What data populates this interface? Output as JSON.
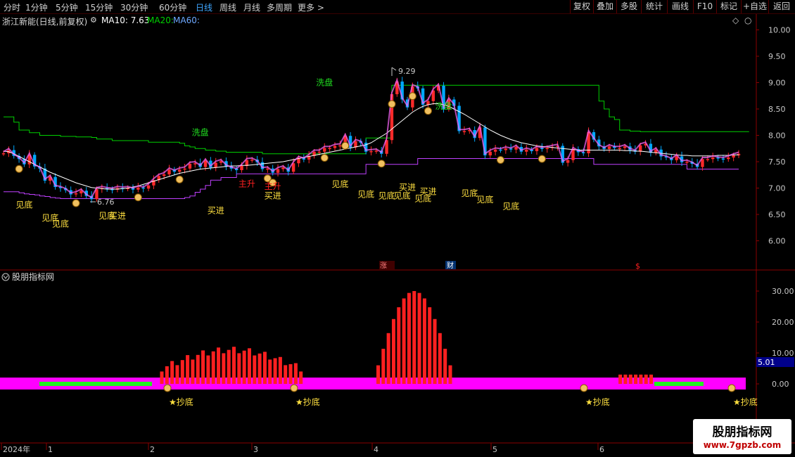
{
  "toolbar": {
    "timeframes": [
      "分时",
      "1分钟",
      "5分钟",
      "15分钟",
      "30分钟",
      "60分钟",
      "日线",
      "周线",
      "月线",
      "多周期",
      "更多 >"
    ],
    "active_timeframe": "日线",
    "right_buttons": [
      "复权",
      "叠加",
      "多股",
      "统计",
      "画线",
      "F10",
      "标记",
      "+自选",
      "返回"
    ]
  },
  "main_panel": {
    "stock_title": "浙江新能(日线,前复权)",
    "ma10_label": "MA10: 7.63",
    "ma20_label": "MA20:",
    "ma60_label": "MA60:",
    "colors": {
      "ma10": "#ffffff",
      "ma20": "#00d000",
      "ma60": "#6ea8ff",
      "up": "#ff2a2a",
      "down": "#00a8ff",
      "pink": "#ff66ff"
    },
    "high_marker": "9.29",
    "low_marker": "6.76",
    "event_labels": [
      "涨",
      "财",
      "$"
    ]
  },
  "indicator_panel": {
    "title": "股朋指标网",
    "current_value": "5.01",
    "signal_label": "★抄底"
  },
  "time_axis": [
    "2024年",
    "1",
    "2",
    "3",
    "4",
    "5",
    "6"
  ],
  "watermark": {
    "line1": "股朋指标网",
    "line2": "www.7gpzb.com"
  },
  "chart_data": [
    {
      "type": "candlestick",
      "title": "浙江新能(日线,前复权)",
      "y_ticks": [
        "10.00",
        "9.50",
        "9.00",
        "8.50",
        "8.00",
        "7.50",
        "7.00",
        "6.50",
        "6.00"
      ],
      "ylim": [
        5.6,
        10.1
      ],
      "close": [
        7.66,
        7.72,
        7.61,
        7.55,
        7.45,
        7.63,
        7.41,
        7.37,
        7.14,
        7.21,
        7.02,
        7.0,
        6.96,
        6.88,
        6.9,
        6.95,
        6.85,
        6.79,
        6.98,
        7.0,
        6.98,
        6.97,
        7.0,
        6.99,
        7.0,
        6.97,
        7.01,
        6.99,
        7.05,
        7.15,
        7.23,
        7.26,
        7.35,
        7.31,
        7.35,
        7.37,
        7.46,
        7.47,
        7.4,
        7.52,
        7.39,
        7.48,
        7.51,
        7.41,
        7.37,
        7.34,
        7.42,
        7.53,
        7.54,
        7.49,
        7.36,
        7.37,
        7.29,
        7.36,
        7.39,
        7.31,
        7.47,
        7.57,
        7.54,
        7.61,
        7.69,
        7.69,
        7.76,
        7.76,
        7.8,
        7.81,
        7.99,
        7.77,
        7.89,
        7.86,
        7.69,
        7.7,
        7.71,
        7.65,
        7.91,
        8.78,
        9.02,
        8.68,
        8.53,
        8.93,
        8.89,
        8.58,
        8.65,
        8.85,
        8.94,
        8.5,
        8.68,
        8.56,
        8.08,
        8.08,
        8.1,
        7.95,
        8.15,
        7.62,
        7.69,
        7.73,
        7.72,
        7.75,
        7.73,
        7.78,
        7.69,
        7.73,
        7.7,
        7.76,
        7.74,
        7.76,
        7.78,
        7.8,
        7.48,
        7.53,
        7.74,
        7.68,
        7.66,
        8.06,
        7.92,
        7.79,
        7.74,
        7.79,
        7.76,
        7.76,
        7.79,
        7.72,
        7.69,
        7.81,
        7.84,
        7.67,
        7.73,
        7.6,
        7.58,
        7.53,
        7.6,
        7.49,
        7.5,
        7.46,
        7.4,
        7.55,
        7.55,
        7.58,
        7.56,
        7.55,
        7.58,
        7.62,
        7.65
      ],
      "ma10": [
        7.7,
        7.69,
        7.65,
        7.6,
        7.55,
        7.5,
        7.45,
        7.4,
        7.35,
        7.3,
        7.26,
        7.22,
        7.18,
        7.14,
        7.1,
        7.07,
        7.04,
        7.01,
        7.0,
        6.99,
        6.98,
        6.98,
        6.98,
        6.99,
        7.0,
        7.02,
        7.04,
        7.07,
        7.1,
        7.13,
        7.16,
        7.19,
        7.22,
        7.25,
        7.28,
        7.3,
        7.32,
        7.34,
        7.36,
        7.37,
        7.38,
        7.39,
        7.4,
        7.41,
        7.42,
        7.42,
        7.43,
        7.43,
        7.44,
        7.45,
        7.46,
        7.47,
        7.48,
        7.49,
        7.5,
        7.52,
        7.54,
        7.56,
        7.58,
        7.6,
        7.62,
        7.64,
        7.66,
        7.68,
        7.7,
        7.72,
        7.74,
        7.76,
        7.78,
        7.8,
        7.82,
        7.86,
        7.92,
        7.98,
        8.04,
        8.12,
        8.2,
        8.28,
        8.36,
        8.44,
        8.5,
        8.55,
        8.58,
        8.6,
        8.6,
        8.58,
        8.55,
        8.5,
        8.45,
        8.4,
        8.34,
        8.28,
        8.22,
        8.16,
        8.1,
        8.05,
        8.0,
        7.96,
        7.92,
        7.89,
        7.86,
        7.84,
        7.82,
        7.8,
        7.79,
        7.78,
        7.77,
        7.76,
        7.75,
        7.74,
        7.73,
        7.72,
        7.72,
        7.72,
        7.72,
        7.72,
        7.72,
        7.72,
        7.72,
        7.72,
        7.71,
        7.71,
        7.7,
        7.7,
        7.69,
        7.68,
        7.67,
        7.66,
        7.65,
        7.64,
        7.63,
        7.62,
        7.62,
        7.61,
        7.61,
        7.61,
        7.61,
        7.61,
        7.62,
        7.62,
        7.62,
        7.63,
        7.63
      ],
      "upper_band": [
        8.35,
        8.35,
        8.25,
        8.1,
        8.1,
        8.05,
        8.05,
        8.0,
        8.0,
        8.0,
        8.0,
        7.98,
        7.98,
        7.98,
        7.97,
        7.97,
        7.97,
        7.96,
        7.93,
        7.93,
        7.93,
        7.9,
        7.9,
        7.9,
        7.9,
        7.9,
        7.9,
        7.9,
        7.87,
        7.87,
        7.87,
        7.87,
        7.87,
        7.87,
        7.85,
        7.8,
        7.78,
        7.75,
        7.75,
        7.72,
        7.72,
        7.7,
        7.7,
        7.68,
        7.68,
        7.68,
        7.68,
        7.68,
        7.68,
        7.68,
        7.65,
        7.65,
        7.65,
        7.65,
        7.65,
        7.65,
        7.65,
        7.65,
        7.65,
        7.65,
        7.65,
        7.65,
        7.65,
        7.65,
        7.65,
        7.65,
        7.65,
        7.65,
        7.65,
        7.65,
        7.95,
        7.95,
        7.95,
        7.95,
        7.95,
        8.95,
        8.95,
        8.95,
        8.95,
        8.95,
        8.95,
        8.95,
        8.95,
        8.95,
        8.95,
        8.95,
        8.95,
        8.95,
        8.95,
        8.95,
        8.95,
        8.95,
        8.95,
        8.95,
        8.95,
        8.95,
        8.95,
        8.95,
        8.95,
        8.95,
        8.95,
        8.95,
        8.95,
        8.95,
        8.95,
        8.95,
        8.95,
        8.95,
        8.95,
        8.95,
        8.95,
        8.95,
        8.95,
        8.95,
        8.95,
        8.65,
        8.5,
        8.35,
        8.3,
        8.1,
        8.1,
        8.08,
        8.08,
        8.07,
        8.07,
        8.07,
        8.07,
        8.07,
        8.07,
        8.07,
        8.07,
        8.07,
        8.07,
        8.07,
        8.07,
        8.07,
        8.07,
        8.07,
        8.07,
        8.07,
        8.07,
        8.07,
        8.07,
        8.07,
        8.07
      ],
      "lower_band": [
        6.93,
        6.93,
        6.93,
        6.91,
        6.89,
        6.88,
        6.87,
        6.85,
        6.84,
        6.82,
        6.81,
        6.8,
        6.8,
        6.8,
        6.8,
        6.8,
        6.8,
        6.8,
        6.8,
        6.8,
        6.8,
        6.8,
        6.8,
        6.8,
        6.8,
        6.8,
        6.8,
        6.8,
        6.8,
        6.8,
        6.8,
        6.8,
        6.8,
        6.8,
        6.8,
        6.82,
        6.85,
        6.92,
        6.98,
        7.05,
        7.15,
        7.15,
        7.2,
        7.2,
        7.2,
        7.27,
        7.27,
        7.27,
        7.27,
        7.27,
        7.27,
        7.27,
        7.27,
        7.27,
        7.27,
        7.27,
        7.27,
        7.27,
        7.27,
        7.27,
        7.27,
        7.27,
        7.27,
        7.27,
        7.27,
        7.27,
        7.27,
        7.27,
        7.27,
        7.27,
        7.45,
        7.45,
        7.45,
        7.45,
        7.45,
        7.45,
        7.45,
        7.45,
        7.45,
        7.45,
        7.56,
        7.56,
        7.56,
        7.56,
        7.56,
        7.56,
        7.56,
        7.56,
        7.56,
        7.56,
        7.56,
        7.56,
        7.56,
        7.56,
        7.56,
        7.56,
        7.56,
        7.56,
        7.56,
        7.56,
        7.56,
        7.56,
        7.56,
        7.56,
        7.56,
        7.56,
        7.56,
        7.56,
        7.56,
        7.56,
        7.56,
        7.56,
        7.56,
        7.56,
        7.45,
        7.45,
        7.45,
        7.45,
        7.45,
        7.45,
        7.45,
        7.45,
        7.45,
        7.45,
        7.45,
        7.45,
        7.45,
        7.45,
        7.45,
        7.45,
        7.45,
        7.45,
        7.36,
        7.36,
        7.36,
        7.36,
        7.36,
        7.36,
        7.36,
        7.36,
        7.36,
        7.36,
        7.36
      ],
      "annotations": [
        {
          "text": "洗盘",
          "date_index": 38,
          "price": 8.0
        },
        {
          "text": "洗盘",
          "date_index": 62,
          "price": 8.95
        },
        {
          "text": "洗盘",
          "date_index": 85,
          "price": 8.5
        },
        {
          "text": "见底",
          "date_index": 4,
          "price": 6.63
        },
        {
          "text": "见底",
          "date_index": 9,
          "price": 6.38
        },
        {
          "text": "见底",
          "date_index": 11,
          "price": 6.27
        },
        {
          "text": "见底",
          "date_index": 20,
          "price": 6.42
        },
        {
          "text": "买进",
          "date_index": 22,
          "price": 6.42
        },
        {
          "text": "买进",
          "date_index": 41,
          "price": 6.52
        },
        {
          "text": "主升",
          "date_index": 47,
          "price": 7.03
        },
        {
          "text": "主升",
          "date_index": 52,
          "price": 6.98
        },
        {
          "text": "买进",
          "date_index": 52,
          "price": 6.8
        },
        {
          "text": "见底",
          "date_index": 65,
          "price": 7.02
        },
        {
          "text": "见底",
          "date_index": 70,
          "price": 6.83
        },
        {
          "text": "见底",
          "date_index": 74,
          "price": 6.8
        },
        {
          "text": "见底",
          "date_index": 77,
          "price": 6.8
        },
        {
          "text": "买进",
          "date_index": 78,
          "price": 6.96
        },
        {
          "text": "见底",
          "date_index": 81,
          "price": 6.75
        },
        {
          "text": "买进",
          "date_index": 82,
          "price": 6.88
        },
        {
          "text": "见底",
          "date_index": 90,
          "price": 6.85
        },
        {
          "text": "见底",
          "date_index": 93,
          "price": 6.73
        },
        {
          "text": "见底",
          "date_index": 98,
          "price": 6.6
        }
      ]
    },
    {
      "type": "bar",
      "title": "股朋指标网",
      "y_ticks": [
        "30.00",
        "20.00",
        "10.00",
        "0.00"
      ],
      "ylim": [
        -6,
        33
      ],
      "values": [
        0,
        0,
        0,
        0,
        0,
        0,
        0,
        0,
        0,
        0,
        0,
        0,
        0,
        0,
        0,
        0,
        0,
        0,
        0,
        0,
        0,
        0,
        0,
        0,
        0,
        0,
        0,
        0,
        0,
        0,
        0,
        0,
        0,
        0,
        0,
        0,
        0,
        0,
        0,
        0,
        0,
        0,
        0,
        0,
        0,
        0,
        0,
        0,
        0,
        0,
        0,
        0,
        0,
        0,
        0,
        0,
        0,
        0,
        0,
        0,
        0,
        0,
        0,
        0,
        0,
        0,
        0,
        0,
        0,
        0,
        0,
        0,
        0,
        0,
        0,
        0,
        0,
        0,
        0,
        0,
        0,
        0,
        0,
        0,
        0,
        0,
        0,
        0,
        0,
        0,
        0,
        0,
        0,
        0,
        0,
        0,
        0,
        0,
        0,
        0,
        0,
        0,
        0,
        0,
        0,
        0,
        0,
        0,
        0,
        0,
        0,
        0,
        0,
        0,
        0,
        0,
        0,
        0,
        0,
        0,
        0,
        0,
        0,
        0,
        0,
        0,
        0,
        0,
        0,
        0,
        0,
        0,
        0,
        0,
        0,
        0,
        0,
        0,
        0,
        0,
        0,
        0,
        0
      ],
      "latest": 5.01
    }
  ]
}
